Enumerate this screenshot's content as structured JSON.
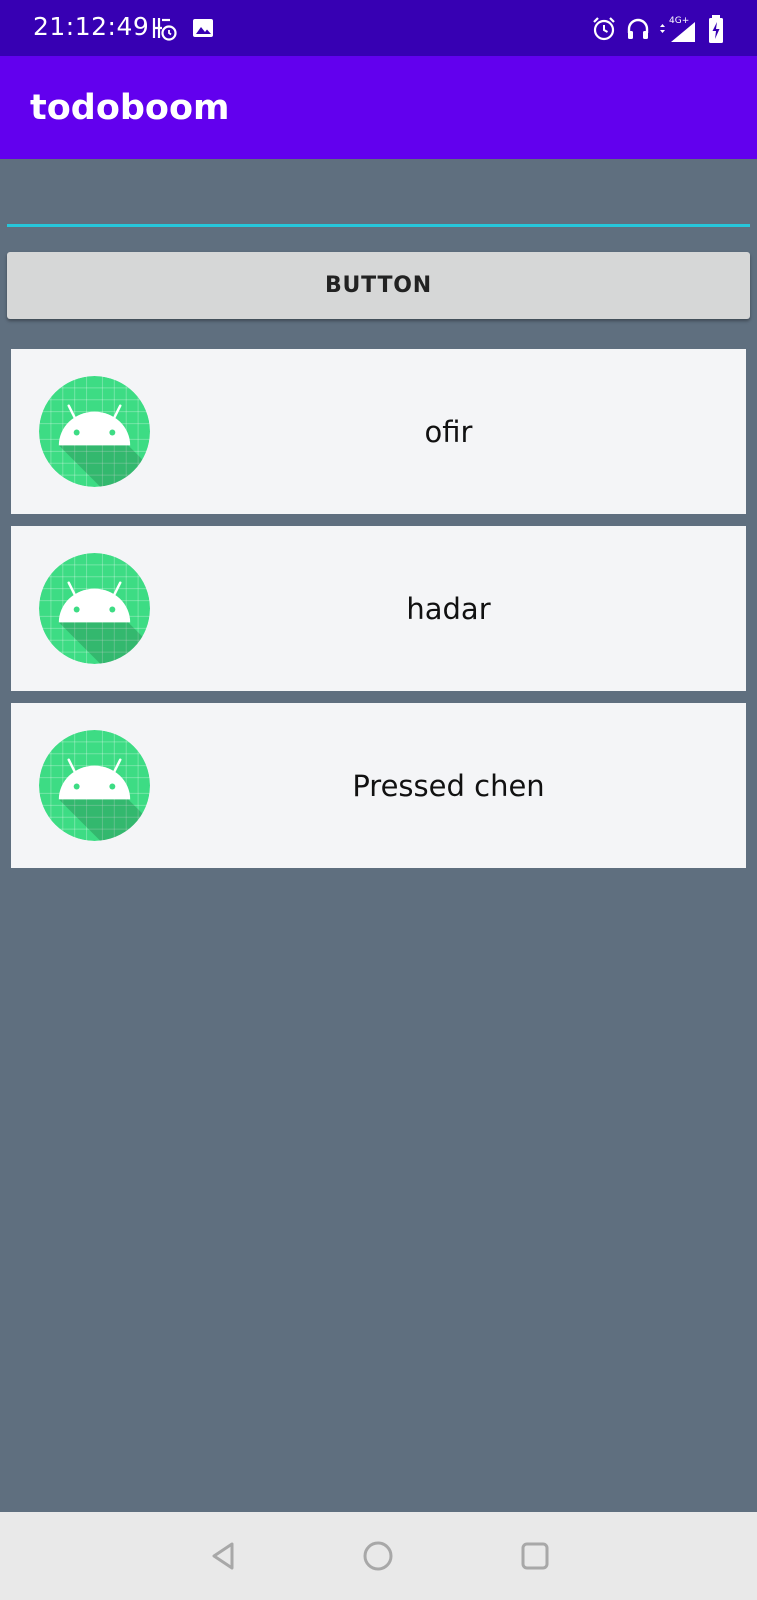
{
  "status_bar": {
    "time": "21:12:49",
    "network": "4G+",
    "icons": [
      "notification-app-icon",
      "gallery-icon",
      "alarm-icon",
      "headphones-icon",
      "signal-icon",
      "battery-icon"
    ],
    "color": "#3700b3"
  },
  "app_bar": {
    "title": "todoboom",
    "color": "#6200ee"
  },
  "input": {
    "value": "",
    "underline_color": "#26c6da"
  },
  "button": {
    "label": "BUTTON"
  },
  "todos": [
    {
      "text": "ofir",
      "icon": "android-robot-icon"
    },
    {
      "text": "hadar",
      "icon": "android-robot-icon"
    },
    {
      "text": "Pressed chen",
      "icon": "android-robot-icon"
    }
  ],
  "nav_bar": {
    "buttons": [
      "back-icon",
      "home-icon",
      "recents-icon"
    ]
  },
  "colors": {
    "background": "#5f6f7f",
    "item_background": "#f4f5f7",
    "android_green": "#3ddc84"
  }
}
